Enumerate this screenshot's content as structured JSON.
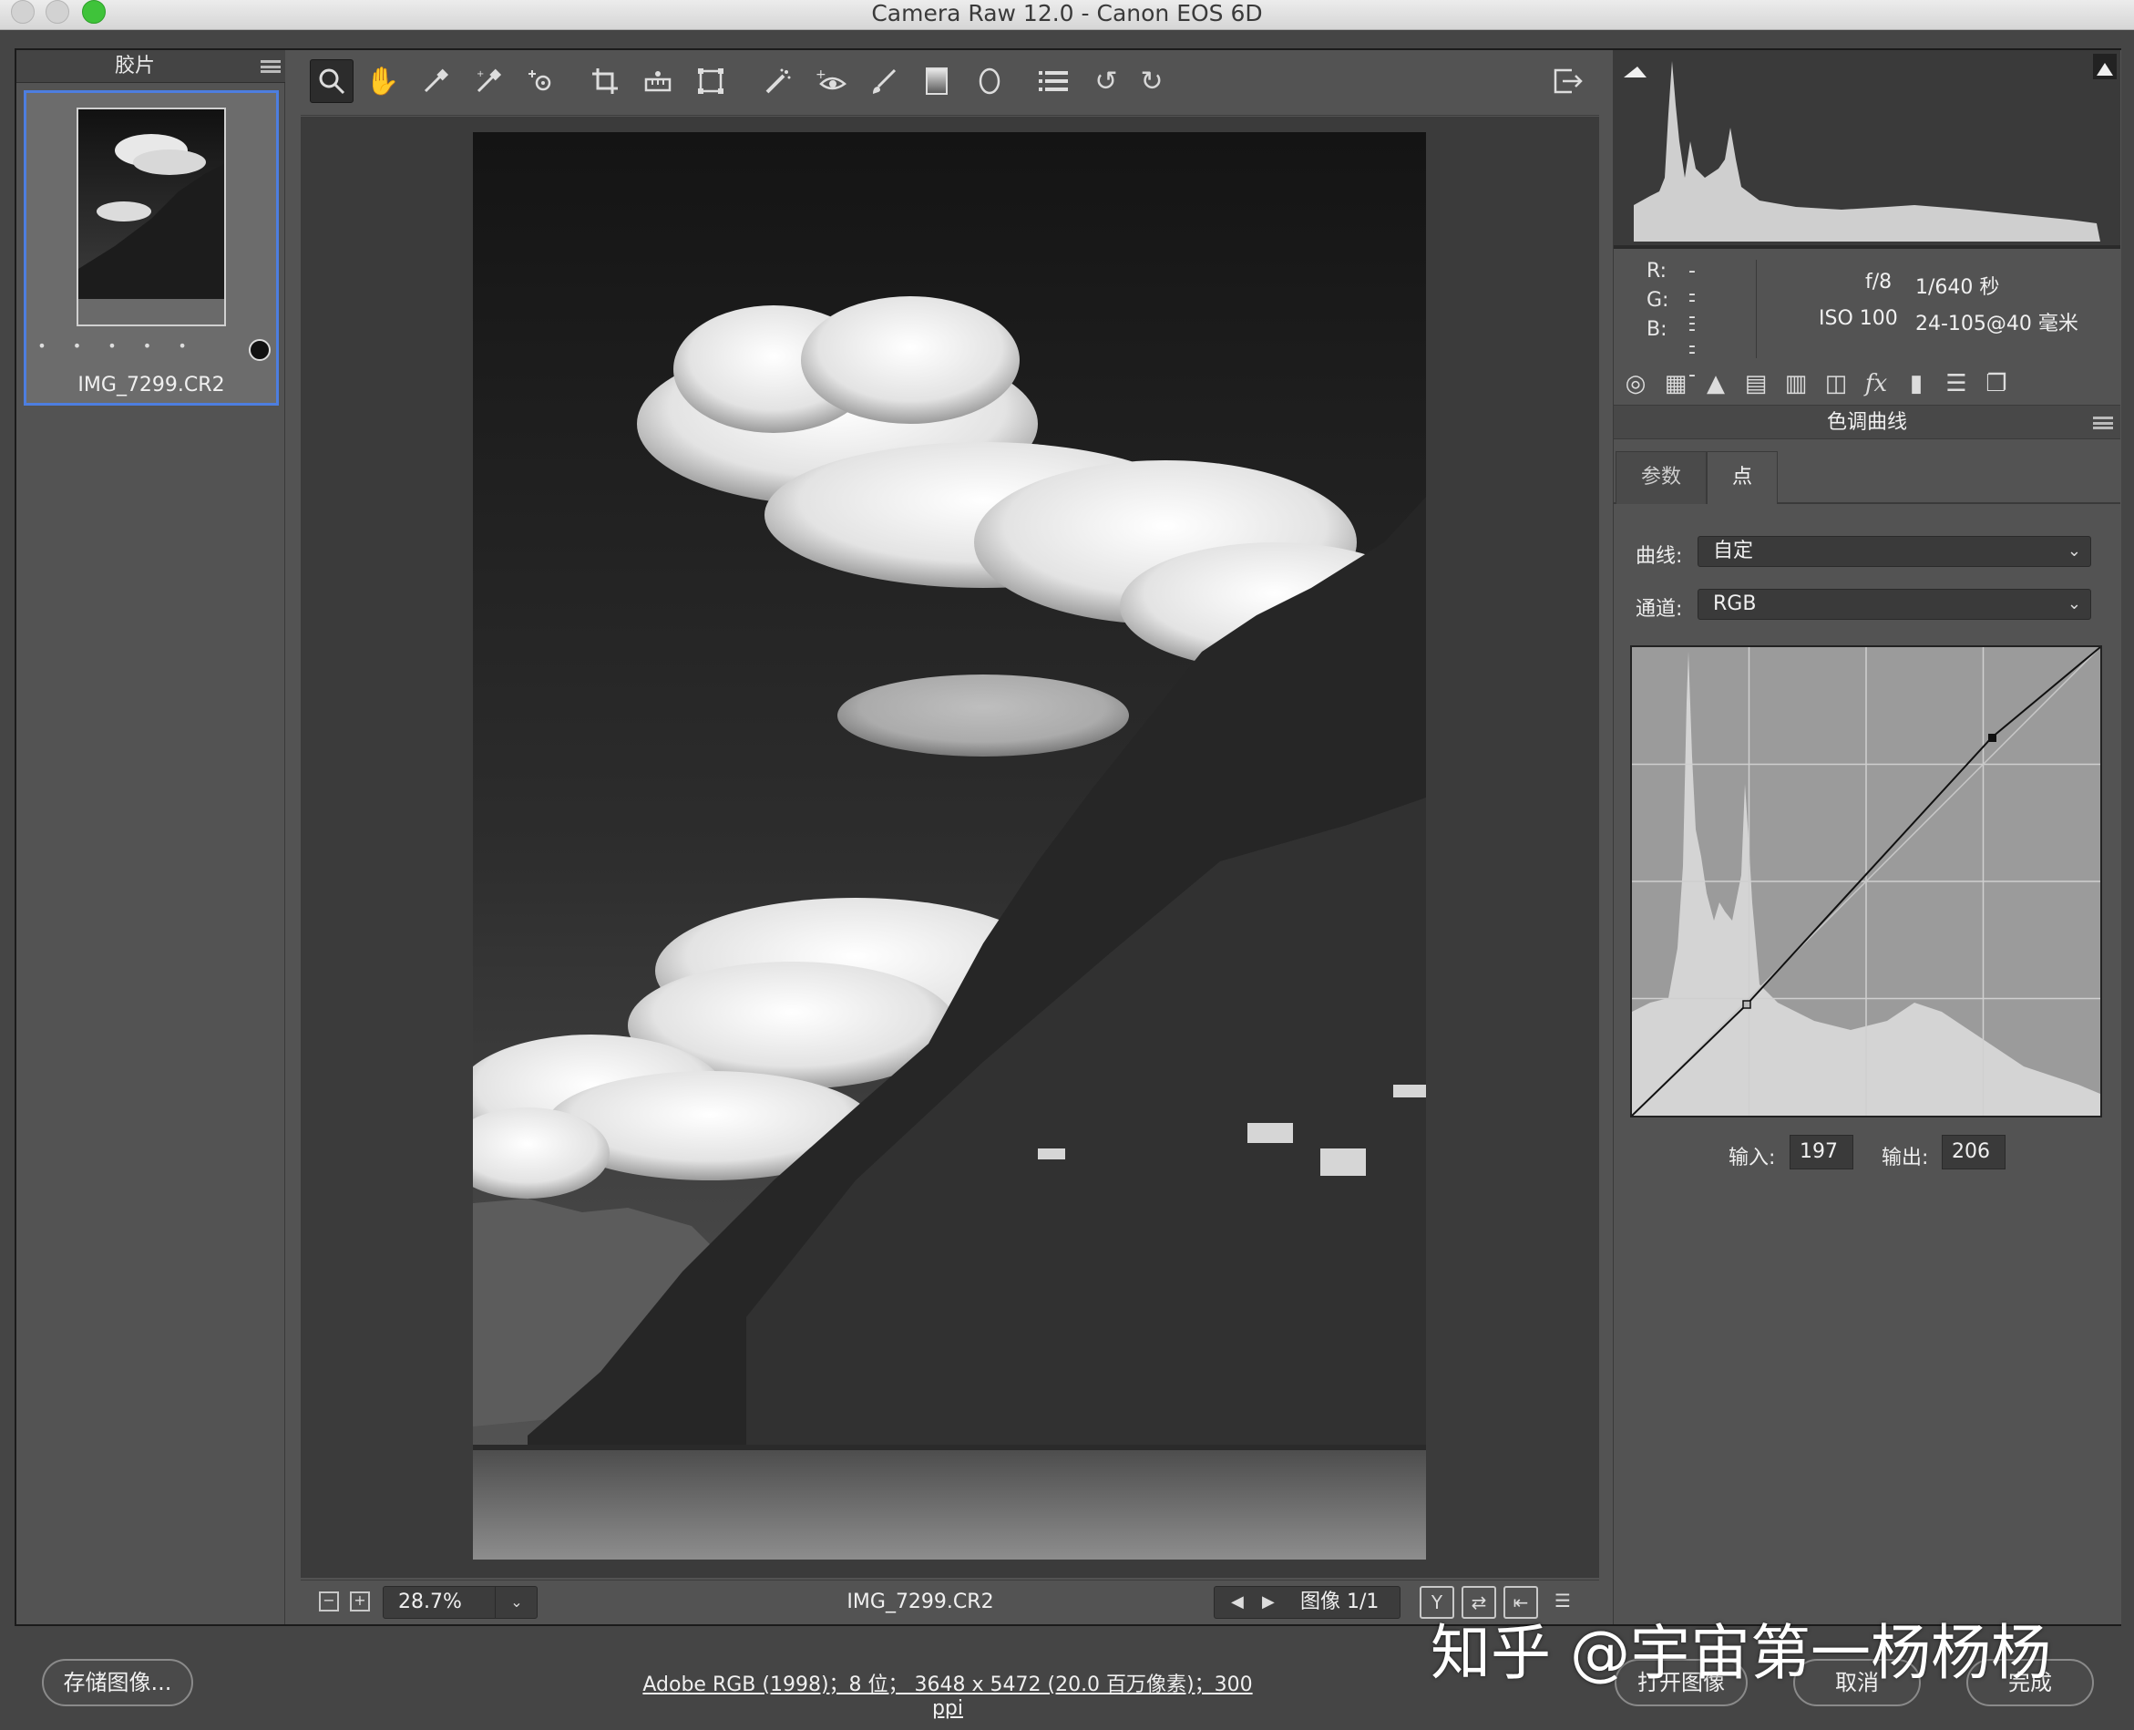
{
  "window": {
    "title": "Camera Raw 12.0 -  Canon EOS 6D"
  },
  "filmstrip": {
    "header": "胶片",
    "item": {
      "filename": "IMG_7299.CR2",
      "rating_dots": "• • • • •"
    }
  },
  "toolbar": {
    "tools": [
      "zoom-tool",
      "hand-tool",
      "white-balance-tool",
      "color-sampler-tool",
      "targeted-adjustment-tool",
      "crop-tool",
      "straighten-tool",
      "transform-tool",
      "spot-removal-tool",
      "red-eye-tool",
      "adjustment-brush-tool",
      "graduated-filter-tool",
      "radial-filter-tool",
      "presets-list-tool",
      "rotate-left-tool",
      "rotate-right-tool"
    ],
    "fullscreen_icon": "fullscreen-icon"
  },
  "status": {
    "zoom": "28.7%",
    "filename": "IMG_7299.CR2",
    "image_counter": "图像 1/1"
  },
  "info": {
    "r_label": "R:",
    "r_value": "---",
    "g_label": "G:",
    "g_value": "---",
    "b_label": "B:",
    "b_value": "---",
    "aperture": "f/8",
    "shutter": "1/640 秒",
    "iso": "ISO 100",
    "lens": "24-105@40 毫米"
  },
  "panel": {
    "title": "色调曲线",
    "tabs": [
      "参数",
      "点"
    ],
    "active_tab": "点",
    "curve_label": "曲线:",
    "curve_value": "自定",
    "channel_label": "通道:",
    "channel_value": "RGB",
    "input_label": "输入:",
    "input_value": "197",
    "output_label": "输出:",
    "output_value": "206"
  },
  "footer": {
    "save_button": "存储图像...",
    "workflow_link": "Adobe RGB (1998)；8 位；  3648 x 5472 (20.0 百万像素)；300 ppi",
    "open_button": "打开图像",
    "cancel_button": "取消",
    "done_button": "完成"
  },
  "watermark": "知乎 @宇宙第一杨杨杨",
  "colors": {
    "selection_border": "#4d7ee0",
    "close": "#d0d0d0",
    "zoom_green": "#3fc33a"
  }
}
